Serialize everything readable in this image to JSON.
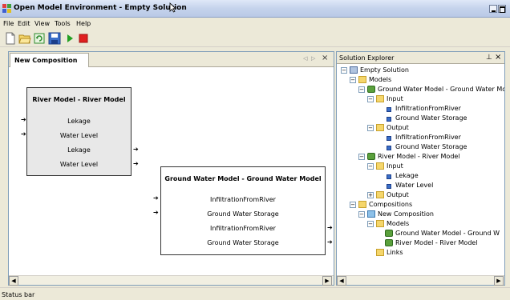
{
  "window": {
    "title": "Open Model Environment - Empty Solution"
  },
  "menu": {
    "items": [
      "File",
      "Edit",
      "View",
      "Tools",
      "Help"
    ]
  },
  "toolbar": {
    "buttons": [
      "new-icon",
      "open-icon",
      "refresh-icon",
      "save-icon",
      "run-icon",
      "stop-icon"
    ]
  },
  "document": {
    "tab_label": "New Composition",
    "models": [
      {
        "title": "River Model - River Model",
        "inputs": [
          "Lekage",
          "Water Level"
        ],
        "outputs": [
          "Lekage",
          "Water Level"
        ]
      },
      {
        "title": "Ground Water Model - Ground Water Model",
        "inputs": [
          "InfiltrationFromRiver",
          "Ground Water Storage"
        ],
        "outputs": [
          "InfiltrationFromRiver",
          "Ground Water Storage"
        ]
      }
    ]
  },
  "solution_explorer": {
    "title": "Solution Explorer",
    "tree": [
      "Empty Solution",
      "Models",
      "Ground Water Model - Ground Water Mo",
      "Input",
      "InfiltrationFromRiver",
      "Ground Water Storage",
      "Output",
      "InfiltrationFromRiver",
      "Ground Water Storage",
      "River Model - River Model",
      "Input",
      "Lekage",
      "Water Level",
      "Output",
      "Compositions",
      "New Composition",
      "Models",
      "Ground Water Model - Ground W",
      "River Model - River Model",
      "Links"
    ]
  },
  "status": {
    "text": "Status bar"
  },
  "colors": {
    "accent": "#3a6ec8",
    "canvas_bg": "#ffffff",
    "chrome_bg": "#ece9d8",
    "stop": "#e02020",
    "run": "#22a022"
  }
}
